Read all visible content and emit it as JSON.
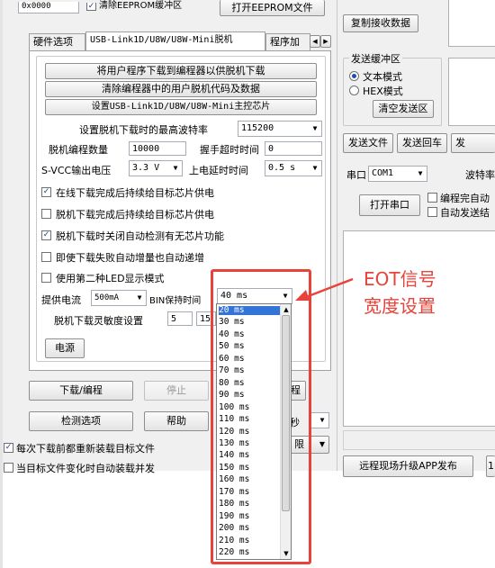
{
  "top_row": {
    "address_value": "0x0000",
    "clear_eeprom_check": "清除EEPROM缓冲区",
    "open_eeprom_button": "打开EEPROM文件"
  },
  "tabs": [
    {
      "label": "硬件选项",
      "active": false
    },
    {
      "label": "USB-Link1D/U8W/U8W-Mini脱机",
      "active": true
    },
    {
      "label": "程序加",
      "active": false
    }
  ],
  "offline_panel": {
    "btn_download_user": "将用户程序下载到编程器以供脱机下载",
    "btn_clear_user": "清除编程器中的用户脱机代码及数据",
    "btn_set_chip": "设置USB-Link1D/U8W/U8W-Mini主控芯片",
    "max_baud_label": "设置脱机下载时的最高波特率",
    "max_baud_value": "115200",
    "count_label": "脱机编程数量",
    "count_value": "10000",
    "handshake_label": "握手超时时间",
    "handshake_value": "0",
    "vcc_label": "S-VCC输出电压",
    "vcc_value": "3.3 V",
    "power_delay_label": "上电延时时间",
    "power_delay_value": "0.5 s",
    "checks": [
      {
        "label": "在线下载完成后持续给目标芯片供电",
        "checked": true
      },
      {
        "label": "脱机下载完成后持续给目标芯片供电",
        "checked": false
      },
      {
        "label": "脱机下载时关闭自动检测有无芯片功能",
        "checked": true
      },
      {
        "label": "即使下载失败自动增量也自动递增",
        "checked": false
      },
      {
        "label": "使用第二种LED显示模式",
        "checked": false
      }
    ],
    "current_label": "提供电流",
    "current_value": "500mA",
    "bin_hold_label": "BIN保持时间",
    "bin_hold_value": "40 ms",
    "sensitivity_label": "脱机下载灵敏度设置",
    "sensitivity_value1": "5",
    "sensitivity_value2": "15",
    "power_button": "电源"
  },
  "bottom_left": {
    "download_button": "下载/编程",
    "stop_button": "停止",
    "program_button": "程",
    "check_options_button": "检测选项",
    "help_button": "帮助",
    "seconds_suffix": "秒",
    "limit_suffix": "限",
    "reload_check": "每次下载前都重新装载目标文件",
    "reload_changed_check": "当目标文件变化时自动装载并发",
    "reload_checked": true
  },
  "right_panel": {
    "copy_recv_button": "复制接收数据",
    "send_buffer_title": "发送缓冲区",
    "text_mode": "文本模式",
    "hex_mode": "HEX模式",
    "clear_send_button": "清空发送区",
    "send_file_button": "发送文件",
    "send_return_button": "发送回车",
    "send_more_button": "发",
    "port_label": "串口",
    "port_value": "COM1",
    "baud_label": "波特率",
    "open_port_button": "打开串口",
    "auto_open_check": "编程完自动",
    "auto_send_check": "自动发送结",
    "remote_upgrade_button": "远程现场升级APP发布",
    "remote_extra_button": "1"
  },
  "dropdown": {
    "items": [
      "20 ms",
      "30 ms",
      "40 ms",
      "50 ms",
      "60 ms",
      "70 ms",
      "80 ms",
      "90 ms",
      "100 ms",
      "110 ms",
      "120 ms",
      "130 ms",
      "140 ms",
      "150 ms",
      "160 ms",
      "170 ms",
      "180 ms",
      "190 ms",
      "200 ms",
      "210 ms",
      "220 ms"
    ],
    "selected_index": 0,
    "scroll_fraction": 0.0
  },
  "annotation": {
    "line1": "EOT信号",
    "line2": "宽度设置",
    "color": "#e8433a"
  }
}
